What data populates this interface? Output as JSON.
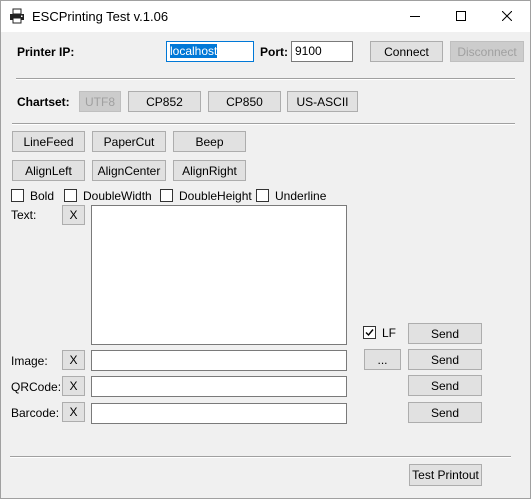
{
  "window": {
    "title": "ESCPrinting Test v.1.06"
  },
  "printer": {
    "ip_label": "Printer IP:",
    "ip_value": "localhost",
    "port_label": "Port:",
    "port_value": "9100",
    "connect_label": "Connect",
    "disconnect_label": "Disconnect"
  },
  "charset": {
    "label": "Chartset:",
    "options": [
      "UTF8",
      "CP852",
      "CP850",
      "US-ASCII"
    ]
  },
  "actions": {
    "linefeed": "LineFeed",
    "papercut": "PaperCut",
    "beep": "Beep",
    "alignleft": "AlignLeft",
    "aligncenter": "AlignCenter",
    "alignright": "AlignRight"
  },
  "styles": {
    "bold": "Bold",
    "doublewidth": "DoubleWidth",
    "doubleheight": "DoubleHeight",
    "underline": "Underline"
  },
  "text": {
    "label": "Text:",
    "clear": "X",
    "lf_label": "LF",
    "send": "Send"
  },
  "image": {
    "label": "Image:",
    "clear": "X",
    "browse": "...",
    "send": "Send"
  },
  "qrcode": {
    "label": "QRCode:",
    "clear": "X",
    "send": "Send"
  },
  "barcode": {
    "label": "Barcode:",
    "clear": "X",
    "send": "Send"
  },
  "footer": {
    "test_printout": "Test Printout"
  }
}
